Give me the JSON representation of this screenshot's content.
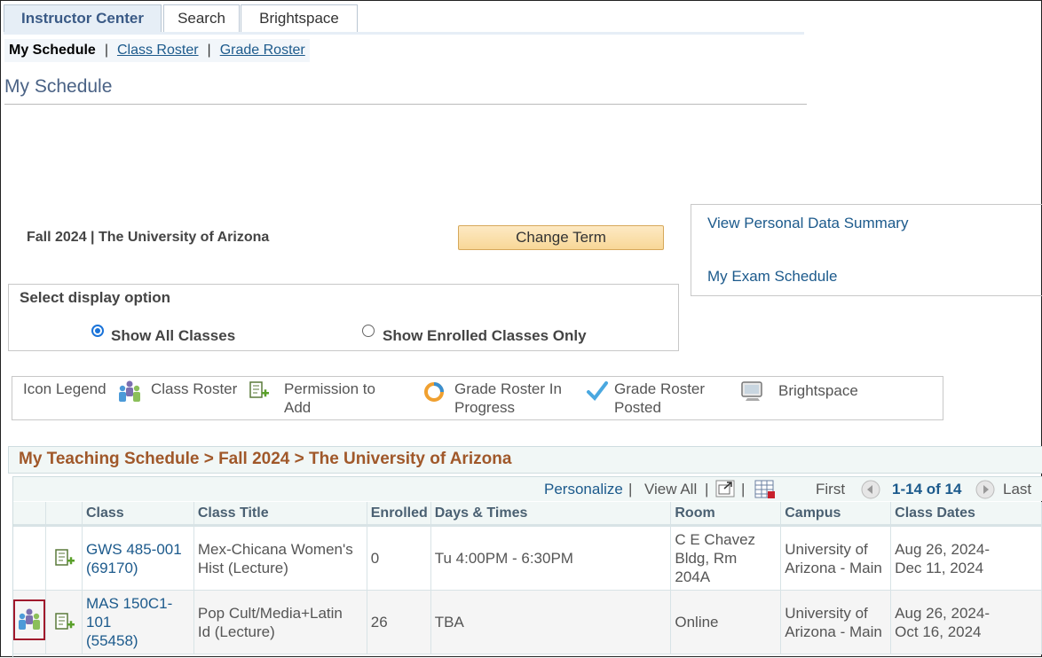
{
  "tabs": [
    "Instructor Center",
    "Search",
    "Brightspace"
  ],
  "subnav": {
    "current": "My Schedule",
    "links": [
      "Class Roster",
      "Grade Roster"
    ]
  },
  "page_title": "My Schedule",
  "term": {
    "label": "Fall 2024 | The University of Arizona",
    "change_button": "Change Term"
  },
  "side_links": [
    "View Personal Data Summary",
    "My Exam Schedule"
  ],
  "display_option": {
    "label": "Select display option",
    "options": [
      "Show All Classes",
      "Show Enrolled Classes Only"
    ],
    "selected": "Show All Classes"
  },
  "legend": {
    "title": "Icon Legend",
    "items": [
      {
        "icon": "class-roster-icon",
        "label": "Class Roster"
      },
      {
        "icon": "permission-to-add-icon",
        "label_line1": "Permission to",
        "label_line2": "Add"
      },
      {
        "icon": "grade-roster-in-progress-icon",
        "label_line1": "Grade Roster In",
        "label_line2": "Progress"
      },
      {
        "icon": "grade-roster-posted-icon",
        "label_line1": "Grade Roster",
        "label_line2": "Posted"
      },
      {
        "icon": "brightspace-icon",
        "label": "Brightspace"
      }
    ]
  },
  "schedule": {
    "header": "My Teaching Schedule > Fall 2024 > The University of Arizona",
    "nav": {
      "personalize": "Personalize",
      "view_all": "View All",
      "first": "First",
      "range": "1-14 of 14",
      "last": "Last"
    },
    "columns": [
      "Class",
      "Class Title",
      "Enrolled",
      "Days & Times",
      "Room",
      "Campus",
      "Class Dates"
    ],
    "rows": [
      {
        "class_line1": "GWS 485-001",
        "class_line2": "(69170)",
        "title_line1": "Mex-Chicana Women's",
        "title_line2": "Hist (Lecture)",
        "enrolled": "0",
        "days_times": "Tu 4:00PM - 6:30PM",
        "room_line1": "C E Chavez",
        "room_line2": "Bldg, Rm",
        "room_line3": "204A",
        "campus_line1": "University of",
        "campus_line2": "Arizona - Main",
        "dates_line1": "Aug 26, 2024-",
        "dates_line2": "Dec 11, 2024"
      },
      {
        "class_line1": "MAS 150C1-",
        "class_line2": "101",
        "class_line3": "(55458)",
        "title_line1": "Pop Cult/Media+Latin",
        "title_line2": "Id (Lecture)",
        "enrolled": "26",
        "days_times": "TBA",
        "room_line1": "Online",
        "campus_line1": "University of",
        "campus_line2": "Arizona - Main",
        "dates_line1": "Aug 26, 2024-",
        "dates_line2": "Oct 16, 2024"
      }
    ]
  }
}
